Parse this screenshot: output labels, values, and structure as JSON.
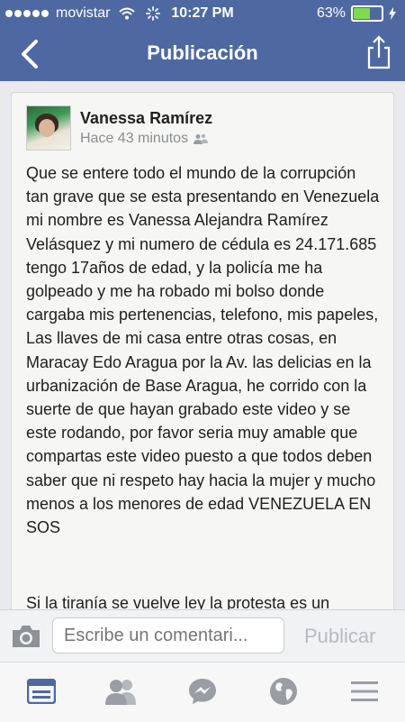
{
  "status_bar": {
    "carrier": "movistar",
    "time": "10:27 PM",
    "battery_percent": "63%",
    "battery_level": 0.63
  },
  "nav": {
    "title": "Publicación"
  },
  "post": {
    "author": "Vanessa Ramírez",
    "time_ago": "Hace 43 minutos",
    "body": "Que se entere todo el mundo de la corrupción tan grave que se esta presentando en Venezuela mi nombre es Vanessa Alejandra Ramírez Velásquez y mi numero de cédula es 24.171.685 tengo 17años de edad, y la policía me ha golpeado y me ha robado mi bolso donde cargaba mis pertenencias, telefono, mis papeles, Las llaves de mi casa entre otras cosas, en Maracay Edo Aragua por la Av. las delicias en la urbanización de Base Aragua, he corrido con la suerte de que hayan grabado este video y se este rodando, por favor seria muy amable que compartas este video puesto a que todos deben saber que ni respeto hay hacia la mujer y mucho menos a los menores de edad VENEZUELA EN SOS",
    "body_continued": "Si la tiranía se vuelve ley la protesta es un"
  },
  "comment_bar": {
    "placeholder": "Escribe un comentari...",
    "publish_label": "Publicar"
  },
  "colors": {
    "header_blue": "#4e69a2",
    "active_tab": "#4e69a2",
    "inactive_tab": "#9a9da3",
    "battery_green": "#7cdc4f"
  },
  "icons": {
    "back": "chevron-left-icon",
    "share": "share-icon",
    "audience": "friends-icon",
    "camera": "camera-icon",
    "tabs": [
      "news-feed-icon",
      "friend-requests-icon",
      "messenger-icon",
      "globe-icon",
      "menu-icon"
    ]
  }
}
